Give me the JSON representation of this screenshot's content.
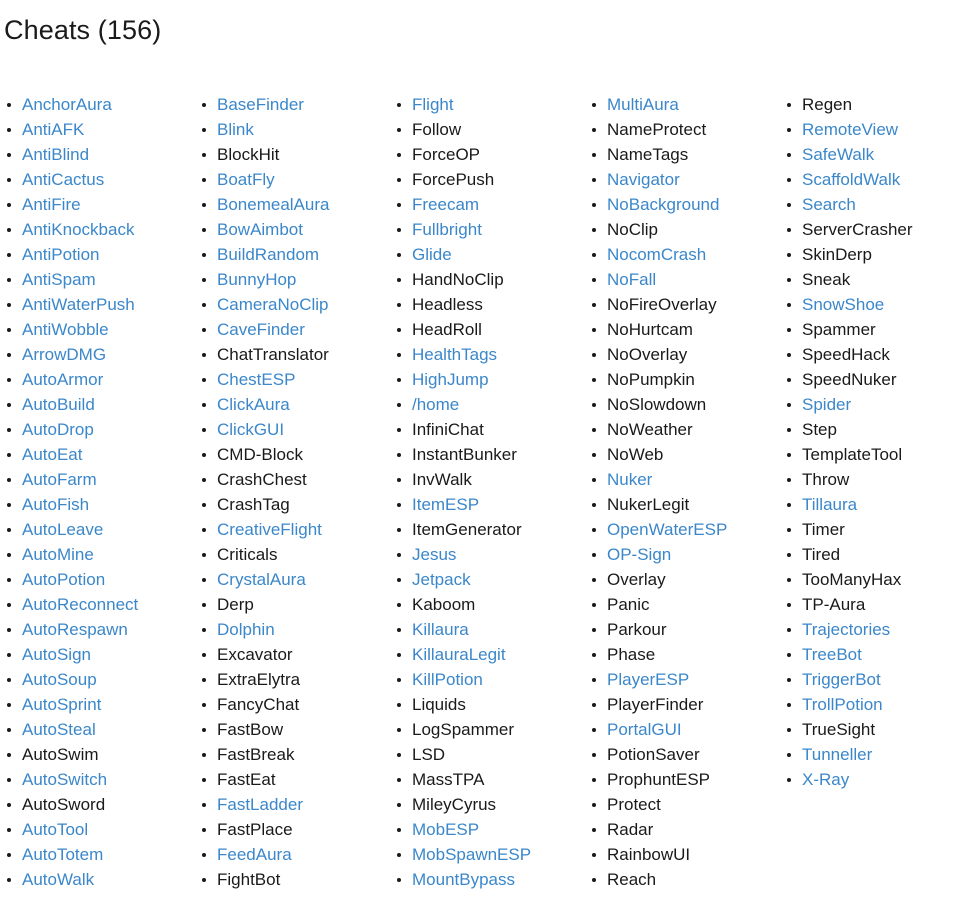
{
  "page": {
    "title": "Cheats (156)",
    "count": 156,
    "link_color": "#3b87ca",
    "text_color": "#1a1a1a",
    "background_color": "#ffffff",
    "bullet_glyph": "bullet-disc"
  },
  "columns": [
    {
      "index": 1,
      "items": [
        {
          "label": "AnchorAura",
          "is_link": true
        },
        {
          "label": "AntiAFK",
          "is_link": true
        },
        {
          "label": "AntiBlind",
          "is_link": true
        },
        {
          "label": "AntiCactus",
          "is_link": true
        },
        {
          "label": "AntiFire",
          "is_link": true
        },
        {
          "label": "AntiKnockback",
          "is_link": true
        },
        {
          "label": "AntiPotion",
          "is_link": true
        },
        {
          "label": "AntiSpam",
          "is_link": true
        },
        {
          "label": "AntiWaterPush",
          "is_link": true
        },
        {
          "label": "AntiWobble",
          "is_link": true
        },
        {
          "label": "ArrowDMG",
          "is_link": true
        },
        {
          "label": "AutoArmor",
          "is_link": true
        },
        {
          "label": "AutoBuild",
          "is_link": true
        },
        {
          "label": "AutoDrop",
          "is_link": true
        },
        {
          "label": "AutoEat",
          "is_link": true
        },
        {
          "label": "AutoFarm",
          "is_link": true
        },
        {
          "label": "AutoFish",
          "is_link": true
        },
        {
          "label": "AutoLeave",
          "is_link": true
        },
        {
          "label": "AutoMine",
          "is_link": true
        },
        {
          "label": "AutoPotion",
          "is_link": true
        },
        {
          "label": "AutoReconnect",
          "is_link": true
        },
        {
          "label": "AutoRespawn",
          "is_link": true
        },
        {
          "label": "AutoSign",
          "is_link": true
        },
        {
          "label": "AutoSoup",
          "is_link": true
        },
        {
          "label": "AutoSprint",
          "is_link": true
        },
        {
          "label": "AutoSteal",
          "is_link": true
        },
        {
          "label": "AutoSwim",
          "is_link": false
        },
        {
          "label": "AutoSwitch",
          "is_link": true
        },
        {
          "label": "AutoSword",
          "is_link": false
        },
        {
          "label": "AutoTool",
          "is_link": true
        },
        {
          "label": "AutoTotem",
          "is_link": true
        },
        {
          "label": "AutoWalk",
          "is_link": true
        }
      ]
    },
    {
      "index": 2,
      "items": [
        {
          "label": "BaseFinder",
          "is_link": true
        },
        {
          "label": "Blink",
          "is_link": true
        },
        {
          "label": "BlockHit",
          "is_link": false
        },
        {
          "label": "BoatFly",
          "is_link": true
        },
        {
          "label": "BonemealAura",
          "is_link": true
        },
        {
          "label": "BowAimbot",
          "is_link": true
        },
        {
          "label": "BuildRandom",
          "is_link": true
        },
        {
          "label": "BunnyHop",
          "is_link": true
        },
        {
          "label": "CameraNoClip",
          "is_link": true
        },
        {
          "label": "CaveFinder",
          "is_link": true
        },
        {
          "label": "ChatTranslator",
          "is_link": false
        },
        {
          "label": "ChestESP",
          "is_link": true
        },
        {
          "label": "ClickAura",
          "is_link": true
        },
        {
          "label": "ClickGUI",
          "is_link": true
        },
        {
          "label": "CMD-Block",
          "is_link": false
        },
        {
          "label": "CrashChest",
          "is_link": false
        },
        {
          "label": "CrashTag",
          "is_link": false
        },
        {
          "label": "CreativeFlight",
          "is_link": true
        },
        {
          "label": "Criticals",
          "is_link": false
        },
        {
          "label": "CrystalAura",
          "is_link": true
        },
        {
          "label": "Derp",
          "is_link": false
        },
        {
          "label": "Dolphin",
          "is_link": true
        },
        {
          "label": "Excavator",
          "is_link": false
        },
        {
          "label": "ExtraElytra",
          "is_link": false
        },
        {
          "label": "FancyChat",
          "is_link": false
        },
        {
          "label": "FastBow",
          "is_link": false
        },
        {
          "label": "FastBreak",
          "is_link": false
        },
        {
          "label": "FastEat",
          "is_link": false
        },
        {
          "label": "FastLadder",
          "is_link": true
        },
        {
          "label": "FastPlace",
          "is_link": false
        },
        {
          "label": "FeedAura",
          "is_link": true
        },
        {
          "label": "FightBot",
          "is_link": false
        }
      ]
    },
    {
      "index": 3,
      "items": [
        {
          "label": "Flight",
          "is_link": true
        },
        {
          "label": "Follow",
          "is_link": false
        },
        {
          "label": "ForceOP",
          "is_link": false
        },
        {
          "label": "ForcePush",
          "is_link": false
        },
        {
          "label": "Freecam",
          "is_link": true
        },
        {
          "label": "Fullbright",
          "is_link": true
        },
        {
          "label": "Glide",
          "is_link": true
        },
        {
          "label": "HandNoClip",
          "is_link": false
        },
        {
          "label": "Headless",
          "is_link": false
        },
        {
          "label": "HeadRoll",
          "is_link": false
        },
        {
          "label": "HealthTags",
          "is_link": true
        },
        {
          "label": "HighJump",
          "is_link": true
        },
        {
          "label": "/home",
          "is_link": true
        },
        {
          "label": "InfiniChat",
          "is_link": false
        },
        {
          "label": "InstantBunker",
          "is_link": false
        },
        {
          "label": "InvWalk",
          "is_link": false
        },
        {
          "label": "ItemESP",
          "is_link": true
        },
        {
          "label": "ItemGenerator",
          "is_link": false
        },
        {
          "label": "Jesus",
          "is_link": true
        },
        {
          "label": "Jetpack",
          "is_link": true
        },
        {
          "label": "Kaboom",
          "is_link": false
        },
        {
          "label": "Killaura",
          "is_link": true
        },
        {
          "label": "KillauraLegit",
          "is_link": true
        },
        {
          "label": "KillPotion",
          "is_link": true
        },
        {
          "label": "Liquids",
          "is_link": false
        },
        {
          "label": "LogSpammer",
          "is_link": false
        },
        {
          "label": "LSD",
          "is_link": false
        },
        {
          "label": "MassTPA",
          "is_link": false
        },
        {
          "label": "MileyCyrus",
          "is_link": false
        },
        {
          "label": "MobESP",
          "is_link": true
        },
        {
          "label": "MobSpawnESP",
          "is_link": true
        },
        {
          "label": "MountBypass",
          "is_link": true
        }
      ]
    },
    {
      "index": 4,
      "items": [
        {
          "label": "MultiAura",
          "is_link": true
        },
        {
          "label": "NameProtect",
          "is_link": false
        },
        {
          "label": "NameTags",
          "is_link": false
        },
        {
          "label": "Navigator",
          "is_link": true
        },
        {
          "label": "NoBackground",
          "is_link": true
        },
        {
          "label": "NoClip",
          "is_link": false
        },
        {
          "label": "NocomCrash",
          "is_link": true
        },
        {
          "label": "NoFall",
          "is_link": true
        },
        {
          "label": "NoFireOverlay",
          "is_link": false
        },
        {
          "label": "NoHurtcam",
          "is_link": false
        },
        {
          "label": "NoOverlay",
          "is_link": false
        },
        {
          "label": "NoPumpkin",
          "is_link": false
        },
        {
          "label": "NoSlowdown",
          "is_link": false
        },
        {
          "label": "NoWeather",
          "is_link": false
        },
        {
          "label": "NoWeb",
          "is_link": false
        },
        {
          "label": "Nuker",
          "is_link": true
        },
        {
          "label": "NukerLegit",
          "is_link": false
        },
        {
          "label": "OpenWaterESP",
          "is_link": true
        },
        {
          "label": "OP-Sign",
          "is_link": true
        },
        {
          "label": "Overlay",
          "is_link": false
        },
        {
          "label": "Panic",
          "is_link": false
        },
        {
          "label": "Parkour",
          "is_link": false
        },
        {
          "label": "Phase",
          "is_link": false
        },
        {
          "label": "PlayerESP",
          "is_link": true
        },
        {
          "label": "PlayerFinder",
          "is_link": false
        },
        {
          "label": "PortalGUI",
          "is_link": true
        },
        {
          "label": "PotionSaver",
          "is_link": false
        },
        {
          "label": "ProphuntESP",
          "is_link": false
        },
        {
          "label": "Protect",
          "is_link": false
        },
        {
          "label": "Radar",
          "is_link": false
        },
        {
          "label": "RainbowUI",
          "is_link": false
        },
        {
          "label": "Reach",
          "is_link": false
        }
      ]
    },
    {
      "index": 5,
      "items": [
        {
          "label": "Regen",
          "is_link": false
        },
        {
          "label": "RemoteView",
          "is_link": true
        },
        {
          "label": "SafeWalk",
          "is_link": true
        },
        {
          "label": "ScaffoldWalk",
          "is_link": true
        },
        {
          "label": "Search",
          "is_link": true
        },
        {
          "label": "ServerCrasher",
          "is_link": false
        },
        {
          "label": "SkinDerp",
          "is_link": false
        },
        {
          "label": "Sneak",
          "is_link": false
        },
        {
          "label": "SnowShoe",
          "is_link": true
        },
        {
          "label": "Spammer",
          "is_link": false
        },
        {
          "label": "SpeedHack",
          "is_link": false
        },
        {
          "label": "SpeedNuker",
          "is_link": false
        },
        {
          "label": "Spider",
          "is_link": true
        },
        {
          "label": "Step",
          "is_link": false
        },
        {
          "label": "TemplateTool",
          "is_link": false
        },
        {
          "label": "Throw",
          "is_link": false
        },
        {
          "label": "Tillaura",
          "is_link": true
        },
        {
          "label": "Timer",
          "is_link": false
        },
        {
          "label": "Tired",
          "is_link": false
        },
        {
          "label": "TooManyHax",
          "is_link": false
        },
        {
          "label": "TP-Aura",
          "is_link": false
        },
        {
          "label": "Trajectories",
          "is_link": true
        },
        {
          "label": "TreeBot",
          "is_link": true
        },
        {
          "label": "TriggerBot",
          "is_link": true
        },
        {
          "label": "TrollPotion",
          "is_link": true
        },
        {
          "label": "TrueSight",
          "is_link": false
        },
        {
          "label": "Tunneller",
          "is_link": true
        },
        {
          "label": "X-Ray",
          "is_link": true
        }
      ]
    }
  ]
}
